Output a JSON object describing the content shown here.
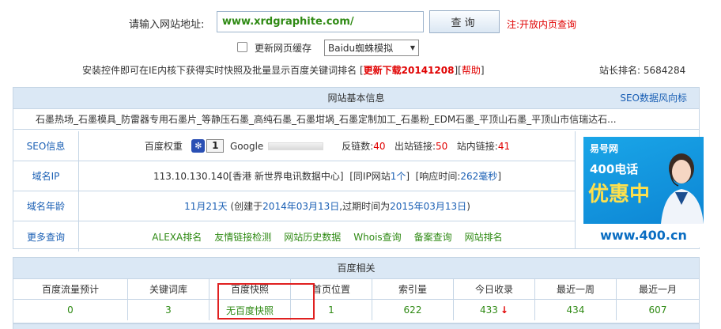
{
  "search": {
    "label": "请输入网站地址:",
    "url_value": "www.xrdgraphite.com/",
    "button_label": "查询",
    "note": "注:开放内页查询"
  },
  "options": {
    "cache_label": "更新网页缓存",
    "spider_selected": "Baidu蜘蛛模拟"
  },
  "install": {
    "text": "安装控件即可在IE内核下获得实时快照及批量显示百度关键词排名",
    "bracket_open": "[",
    "download_label": "更新下载20141208",
    "bracket_mid": "][",
    "help_label": "帮助",
    "bracket_close": "]"
  },
  "rank": {
    "label": "站长排名:",
    "value": "5684284"
  },
  "basic": {
    "title": "网站基本信息",
    "seo_link": "SEO数据风向标",
    "description": "石墨热场_石墨模具_防雷器专用石墨片_等静压石墨_高纯石墨_石墨坩埚_石墨定制加工_石墨粉_EDM石墨_平顶山石墨_平顶山市信瑞达石...",
    "seo": {
      "label": "SEO信息",
      "baidu_weight_label": "百度权重",
      "baidu_weight": "1",
      "google_label": "Google",
      "backlinks_label": "反链数:",
      "backlinks": "40",
      "outlinks_label": "出站链接:",
      "outlinks": "50",
      "inlinks_label": "站内链接:",
      "inlinks": "41"
    },
    "ip": {
      "label": "域名IP",
      "text1": "113.10.130.140[香港 新世界电讯数据中心]",
      "same_ip_open": "[同IP网站",
      "same_ip_count": "1个",
      "same_ip_close": "]",
      "resp_label": "[响应时间:",
      "resp_value": "262毫秒",
      "resp_close": "]"
    },
    "age": {
      "label": "域名年龄",
      "age_value": "11月21天",
      "created_prefix": "(创建于",
      "created": "2014年03月13日",
      "expire_prefix": ",过期时间为",
      "expire": "2015年03月13日",
      "close": ")"
    },
    "more": {
      "label": "更多查询",
      "links": [
        "ALEXA排名",
        "友情链接检测",
        "网站历史数据",
        "Whois查询",
        "备案查询",
        "网站排名"
      ]
    },
    "ad": {
      "brand": "易号网",
      "line1": "400电话",
      "line2": "优惠中",
      "site": "www.400.cn"
    }
  },
  "baidu": {
    "title": "百度相关",
    "headers": [
      "百度流量预计",
      "关键词库",
      "百度快照",
      "首页位置",
      "索引量",
      "今日收录",
      "最近一周",
      "最近一月"
    ],
    "values": [
      "0",
      "3",
      "无百度快照",
      "1",
      "622",
      "433",
      "434",
      "607"
    ],
    "trend_arrow": "↓",
    "colors": {
      "value": "#2f8a14",
      "arrow": "#e00000",
      "highlight": "#e02020"
    }
  }
}
